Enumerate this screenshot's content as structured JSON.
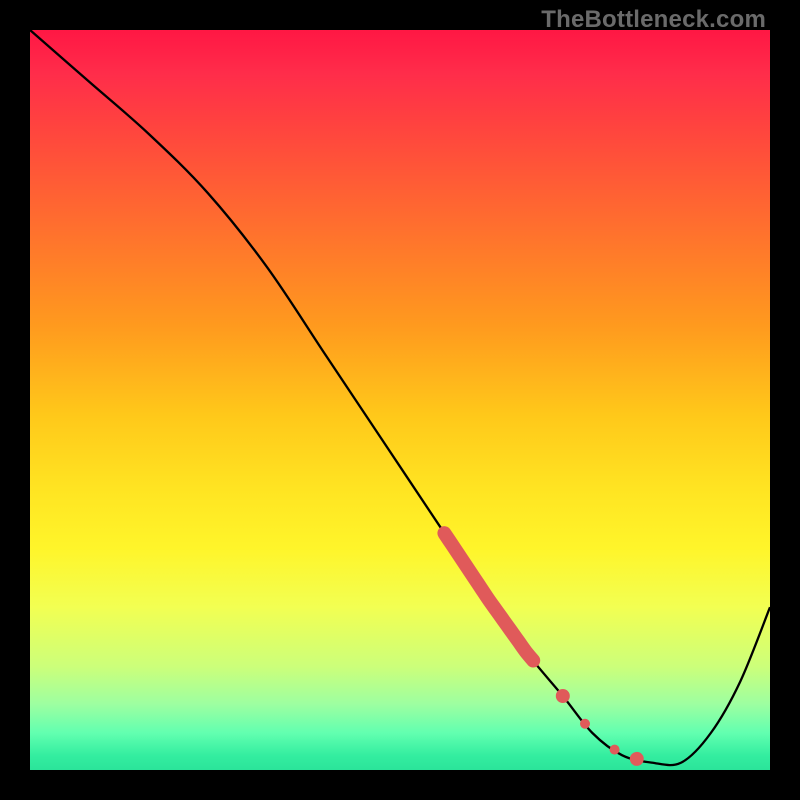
{
  "watermark": "TheBottleneck.com",
  "chart_data": {
    "type": "line",
    "title": "",
    "xlabel": "",
    "ylabel": "",
    "xlim": [
      0,
      100
    ],
    "ylim": [
      0,
      100
    ],
    "series": [
      {
        "name": "curve",
        "x": [
          0,
          8,
          16,
          24,
          32,
          40,
          48,
          56,
          62,
          67,
          72,
          76,
          80,
          84,
          88,
          92,
          96,
          100
        ],
        "values": [
          100,
          93,
          86,
          78,
          68,
          56,
          44,
          32,
          23,
          16,
          10,
          5,
          2,
          1,
          1,
          5,
          12,
          22
        ]
      }
    ],
    "highlight_segment": {
      "x_start": 56,
      "x_end": 68
    },
    "highlight_dots_x": [
      72,
      75,
      79,
      82
    ],
    "colors": {
      "curve": "#000000",
      "highlight": "#e05a5a"
    }
  }
}
